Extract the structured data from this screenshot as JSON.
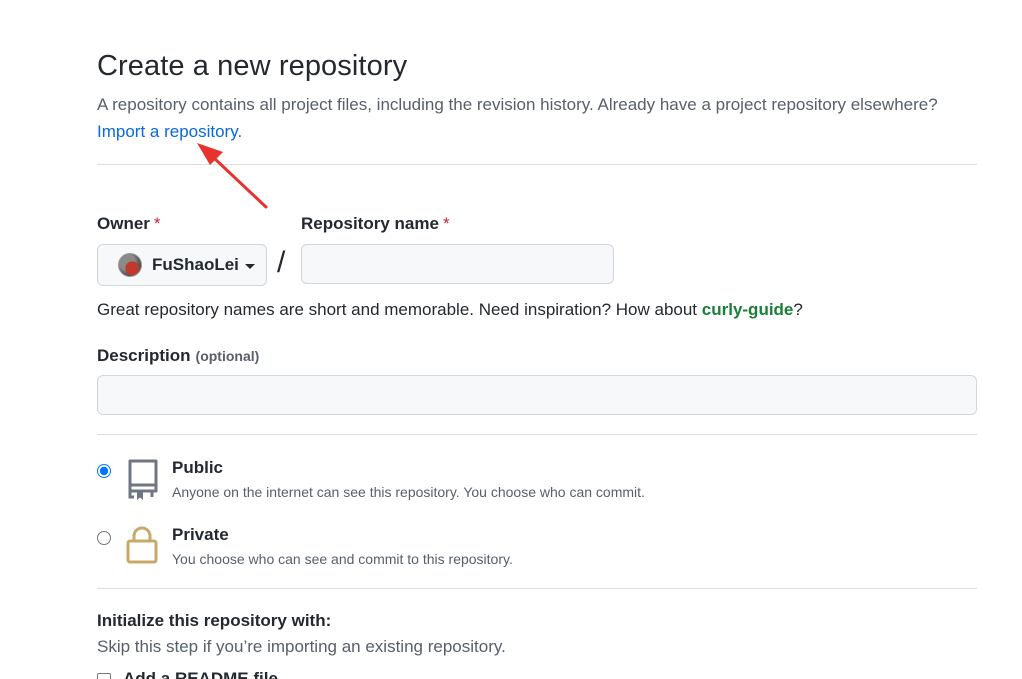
{
  "header": {
    "title": "Create a new repository",
    "subtitle": "A repository contains all project files, including the revision history. Already have a project repository elsewhere?",
    "import_link": "Import a repository."
  },
  "owner": {
    "label": "Owner",
    "required_mark": "*",
    "selected": "FuShaoLei"
  },
  "repo_name": {
    "label": "Repository name",
    "required_mark": "*",
    "value": "",
    "separator": "/"
  },
  "hint": {
    "text": "Great repository names are short and memorable. Need inspiration? How about ",
    "suggestion": "curly-guide",
    "end": "?"
  },
  "description": {
    "label": "Description",
    "optional": "(optional)",
    "value": ""
  },
  "visibility": {
    "selected": "public",
    "public": {
      "title": "Public",
      "desc": "Anyone on the internet can see this repository. You choose who can commit.",
      "icon": "repo-icon"
    },
    "private": {
      "title": "Private",
      "desc": "You choose who can see and commit to this repository.",
      "icon": "lock-icon"
    }
  },
  "initialize": {
    "heading": "Initialize this repository with:",
    "subtitle": "Skip this step if you’re importing an existing repository.",
    "option_partial": "Add a README file"
  },
  "colors": {
    "link": "#0969da",
    "required": "#cf222e",
    "suggestion": "#1a7f37",
    "annotation_arrow": "#e8322e",
    "radio_checked": "#0969da"
  }
}
